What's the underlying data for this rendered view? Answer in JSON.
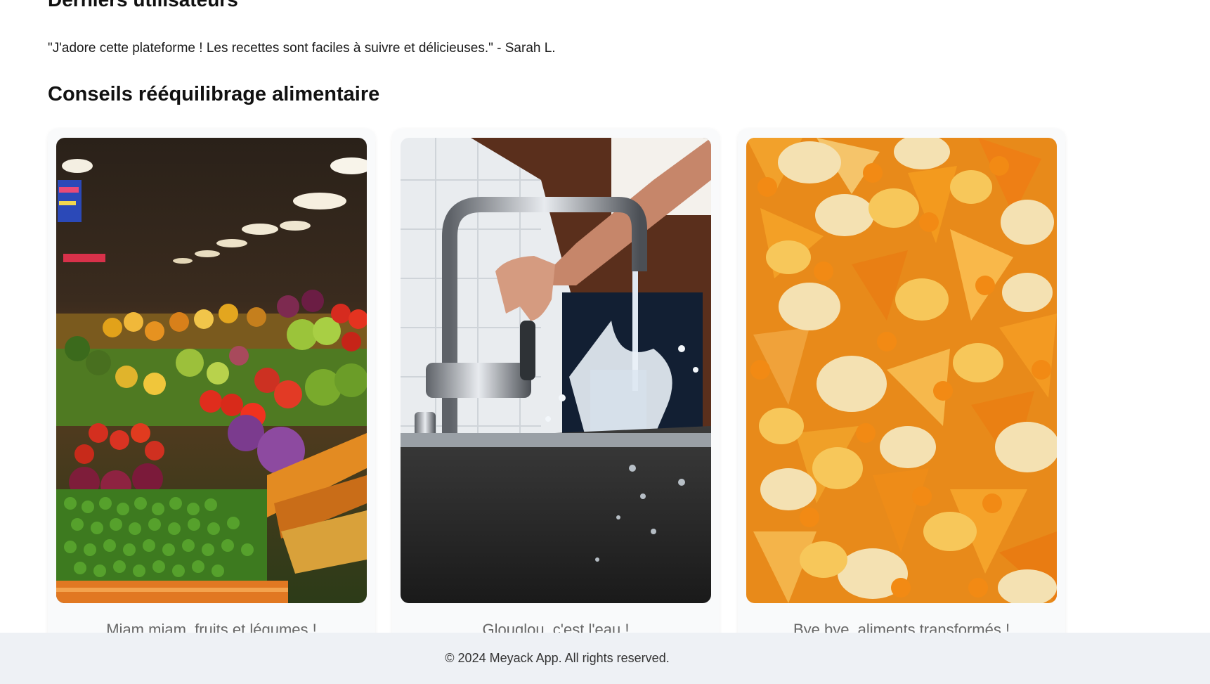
{
  "users_section": {
    "title": "Derniers utilisateurs",
    "testimonial": "\"J'adore cette plateforme ! Les recettes sont faciles à suivre et délicieuses.\" - Sarah L."
  },
  "tips_section": {
    "title": "Conseils rééquilibrage alimentaire",
    "cards": [
      {
        "image": "market-produce-photo",
        "caption": "Miam miam, fruits et légumes !"
      },
      {
        "image": "tap-water-glass-photo",
        "caption": "Glouglou, c'est l'eau !"
      },
      {
        "image": "chips-snacks-photo",
        "caption": "Bye bye, aliments transformés !"
      }
    ]
  },
  "footer": {
    "text": "© 2024 Meyack App. All rights reserved."
  },
  "colors": {
    "footer_bg": "#eef1f5",
    "card_bg": "#f9fafb"
  }
}
